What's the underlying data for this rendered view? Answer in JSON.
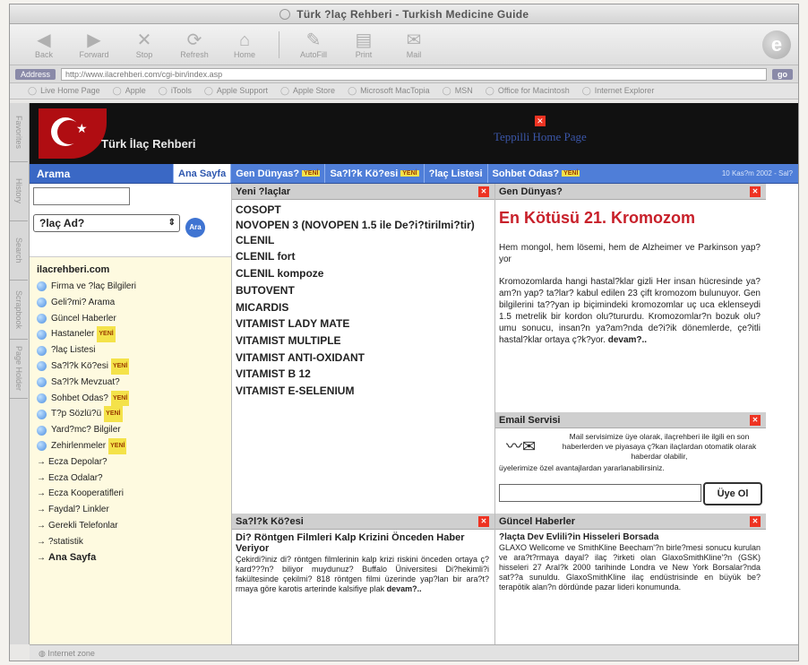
{
  "window": {
    "title": "Türk ?laç Rehberi - Turkish Medicine Guide"
  },
  "toolbar": {
    "buttons": [
      "Back",
      "Forward",
      "Stop",
      "Refresh",
      "Home",
      "AutoFill",
      "Print",
      "Mail"
    ]
  },
  "address": {
    "label": "Address",
    "url": "http://www.ilacrehberi.com/cgi-bin/index.asp",
    "go": "go"
  },
  "favorites": [
    "Live Home Page",
    "Apple",
    "iTools",
    "Apple Support",
    "Apple Store",
    "Microsoft MacTopia",
    "MSN",
    "Office for Macintosh",
    "Internet Explorer"
  ],
  "sidetabs": [
    "Favorites",
    "History",
    "Search",
    "Scrapbook",
    "Page Holder"
  ],
  "status": "Internet zone",
  "site": {
    "title": "Türk İlaç Rehberi",
    "banner": "Teppilli Home Page"
  },
  "nav": {
    "search_label": "Arama",
    "items": [
      {
        "label": "Ana Sayfa",
        "new": ""
      },
      {
        "label": "Gen Dünyas?",
        "new": "YENİ"
      },
      {
        "label": "Sa?l?k Kö?esi",
        "new": "YENİ"
      },
      {
        "label": "?laç Listesi",
        "new": ""
      },
      {
        "label": "Sohbet Odas?",
        "new": "YENİ"
      }
    ],
    "date": "10 Kas?m 2002 - Sal?"
  },
  "sidebar": {
    "select_value": "?laç Ad?",
    "search_button": "Ara",
    "heading": "ilacrehberi.com",
    "items": [
      {
        "label": "Firma ve ?laç Bilgileri",
        "new": ""
      },
      {
        "label": "Geli?mi? Arama",
        "new": ""
      },
      {
        "label": "Güncel Haberler",
        "new": ""
      },
      {
        "label": "Hastaneler",
        "new": "YENİ"
      },
      {
        "label": "?laç Listesi",
        "new": ""
      },
      {
        "label": "Sa?l?k Kö?esi",
        "new": "YENİ"
      },
      {
        "label": "Sa?l?k Mevzuat?",
        "new": ""
      },
      {
        "label": "Sohbet Odas?",
        "new": "YENİ"
      },
      {
        "label": "T?p Sözlü?ü",
        "new": "YENİ"
      },
      {
        "label": "Yard?mc? Bilgiler",
        "new": ""
      },
      {
        "label": "Zehirlenmeler",
        "new": "YENİ"
      }
    ],
    "links": [
      "Ecza Depolar?",
      "Ecza Odalar?",
      "Ecza Kooperatifleri",
      "Faydal? Linkler",
      "Gerekli Telefonlar",
      "?statistik"
    ],
    "home_link": "Ana Sayfa"
  },
  "new_drugs": {
    "title": "Yeni ?laçlar",
    "items": [
      "COSOPT",
      "NOVOPEN 3 (NOVOPEN 1.5 ile De?i?tirilmi?tir)",
      "CLENIL",
      "CLENIL fort",
      "CLENIL kompoze",
      "BUTOVENT",
      "MICARDIS",
      "VITAMIST LADY MATE",
      "VITAMIST MULTIPLE",
      "VITAMIST ANTI-OXIDANT",
      "VITAMIST B 12",
      "VITAMIST E-SELENIUM"
    ]
  },
  "gene": {
    "title": "Gen Dünyas?",
    "headline": "En Kötüsü 21. Kromozom",
    "intro": "Hem mongol, hem lösemi, hem de Alzheimer ve Parkinson yap?yor",
    "body": "Kromozomlarda hangi hastal?klar gizli Her insan hücresinde ya?am?n yap? ta?lar? kabul edilen 23 çift kromozom bulunuyor. Gen bilgilerini ta??yan ip biçimindeki kromozomlar uç uca eklenseydi 1.5 metrelik bir kordon olu?tururdu. Kromozomlar?n bozuk olu?umu sonucu, insan?n ya?am?nda de?i?ik dönemlerde, çe?itli hastal?klar ortaya ç?k?yor.",
    "more": "devam?.."
  },
  "email": {
    "title": "Email Servisi",
    "text": "Mail servisimize üye olarak, ilaçrehberi ile ilgili en son haberlerden ve piyasaya ç?kan ilaçlardan otomatik olarak haberdar olabilir,",
    "text2": "üyelerimize özel avantajlardan yararlanabilirsiniz.",
    "button": "Üye Ol"
  },
  "health": {
    "title": "Sa?l?k Kö?esi",
    "headline": "Di? Röntgen Filmleri Kalp Krizini Önceden Haber Veriyor",
    "body": "Çekirdi?iniz di? röntgen filmlerinin kalp krizi riskini önceden ortaya ç?kard???n? biliyor muydunuz? Buffalo Üniversitesi Di?hekimli?i fakültesinde çekilmi? 818 röntgen filmi üzerinde yap?lan bir ara?t?rmaya göre karotis arterinde kalsifiye plak",
    "more": "devam?.."
  },
  "news": {
    "title": "Güncel Haberler",
    "headline": "?laçta Dev Evlili?in Hisseleri Borsada",
    "body": "GLAXO Wellcome ve SmithKline Beecham'?n birle?mesi sonucu kurulan ve ara?t?rmaya dayal? ilaç ?irketi olan GlaxoSmithKline'?n (GSK) hisseleri 27 Aral?k 2000 tarihinde Londra ve New York Borsalar?nda sat??a sunuldu. GlaxoSmithKline ilaç endüstrisinde en büyük be? terapötik alan?n dördünde pazar lideri konumunda."
  }
}
